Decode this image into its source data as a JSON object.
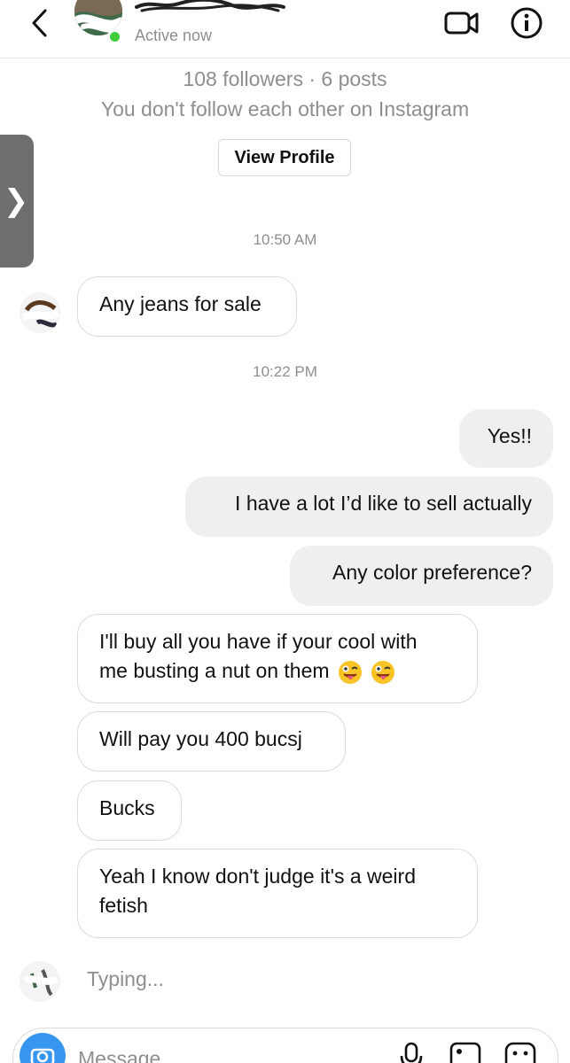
{
  "header": {
    "status": "Active now",
    "back_icon": "chevron-left-icon",
    "video_icon": "video-camera-icon",
    "info_icon": "info-icon"
  },
  "profile": {
    "followers_line": "108 followers · 6 posts",
    "relation_line": "You don't follow each other on Instagram",
    "view_profile_label": "View Profile"
  },
  "drawer": {
    "icon": "chevron-right-icon",
    "glyph": "❯"
  },
  "messages": {
    "time_1": "10:50 AM",
    "msg_1": "Any jeans for sale",
    "time_2": "10:22 PM",
    "out_1": "Yes!!",
    "out_2": "I have a lot I’d like to sell actually",
    "out_3": "Any color preference?",
    "in_2a": "I'll buy all you have if your cool with",
    "in_2b": "me busting a nut on them",
    "in_3": "Will pay you 400 bucsj",
    "in_4": "Bucks",
    "in_5a": "Yeah I know don't judge it's a weird",
    "in_5b": "fetish",
    "emoji_name": "winking-face-with-tongue"
  },
  "typing": "Typing...",
  "composer": {
    "placeholder": "Message...",
    "camera_icon": "camera-icon",
    "mic_icon": "microphone-icon",
    "gallery_icon": "gallery-icon",
    "sticker_icon": "sticker-icon"
  },
  "colors": {
    "online": "#3ecf3b",
    "accent": "#3797f0",
    "outgoing_bubble": "#efefef",
    "secondary_text": "#8e8e8e"
  }
}
